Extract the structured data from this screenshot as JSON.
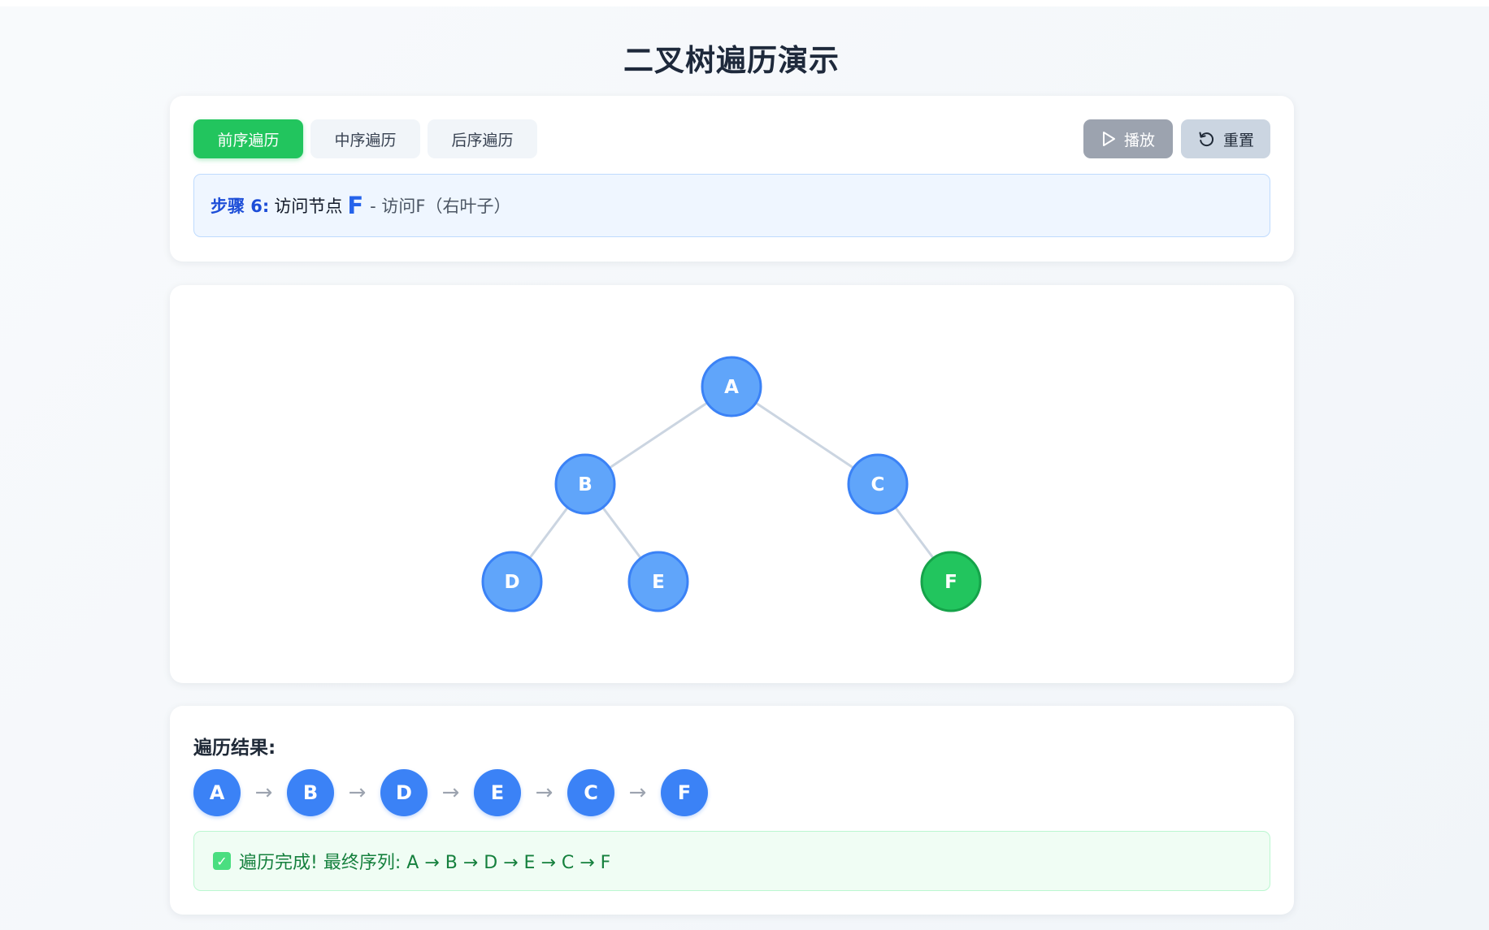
{
  "title": "二叉树遍历演示",
  "tabs": [
    {
      "label": "前序遍历",
      "active": true
    },
    {
      "label": "中序遍历",
      "active": false
    },
    {
      "label": "后序遍历",
      "active": false
    }
  ],
  "controls": {
    "play_label": "播放",
    "reset_label": "重置",
    "play_icon": "play-icon",
    "reset_icon": "reset-icon"
  },
  "step": {
    "label": "步骤 6:",
    "text": "访问节点",
    "node": "F",
    "desc": "- 访问F（右叶子）"
  },
  "tree": {
    "root": "A",
    "nodes": [
      "A",
      "B",
      "C",
      "D",
      "E",
      "F"
    ],
    "children": {
      "A": [
        "B",
        "C"
      ],
      "B": [
        "D",
        "E"
      ],
      "C": [
        null,
        "F"
      ]
    },
    "current": "F",
    "colors": {
      "node_fill": "#60a5fa",
      "node_stroke": "#3b82f6",
      "current_fill": "#22c55e",
      "current_stroke": "#16a34a",
      "edge": "#cbd5e1"
    }
  },
  "result": {
    "heading": "遍历结果:",
    "sequence": [
      "A",
      "B",
      "D",
      "E",
      "C",
      "F"
    ],
    "arrow": "→",
    "done_message": "遍历完成! 最终序列: A → B → D → E → C → F",
    "done_icon": "check-icon"
  }
}
